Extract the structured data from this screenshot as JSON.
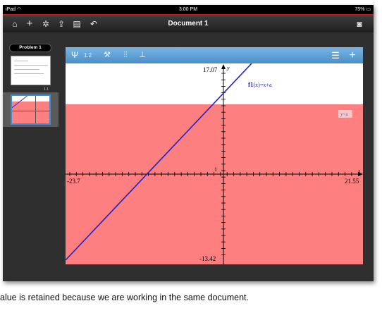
{
  "status_bar": {
    "device": "iPad",
    "wifi_icon": "wifi-icon",
    "time": "3:00 PM",
    "battery": "75%"
  },
  "toolbar": {
    "title": "Document 1",
    "icons": [
      "home-icon",
      "plus-icon",
      "gear-icon",
      "share-icon",
      "book-icon",
      "undo-icon",
      "camera-icon"
    ]
  },
  "sidebar": {
    "problem_label": "Problem 1",
    "page1_label": "1.1"
  },
  "app_toolbar": {
    "zoom_label": "1.2",
    "icons": [
      "graph-tool-icon",
      "wrench-icon",
      "sliders-icon",
      "plot-icon",
      "menu-icon",
      "add-page-icon"
    ]
  },
  "graph": {
    "x_min_label": "-23.7",
    "x_max_label": "21.55",
    "y_max_label": "17.07",
    "y_min_label": "-13.42",
    "y_axis_label": "y",
    "x_axis_label": "x",
    "unit_tick_label": "1",
    "function_name": "f1",
    "function_expr": "(x)=x+a",
    "inequality_label": "y<a",
    "shade_color": "#fe7f7f",
    "line_color": "#2222c8"
  },
  "caption": "alue is retained because we are working in the same document."
}
